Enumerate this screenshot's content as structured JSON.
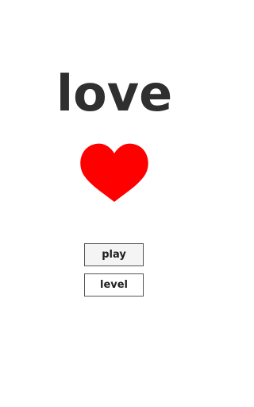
{
  "game": {
    "title": "love",
    "heart_icon": "heart-icon",
    "heart_color": "#ff0000",
    "title_color": "#2f2f2f"
  },
  "menu": {
    "play_label": "play",
    "level_label": "level"
  }
}
